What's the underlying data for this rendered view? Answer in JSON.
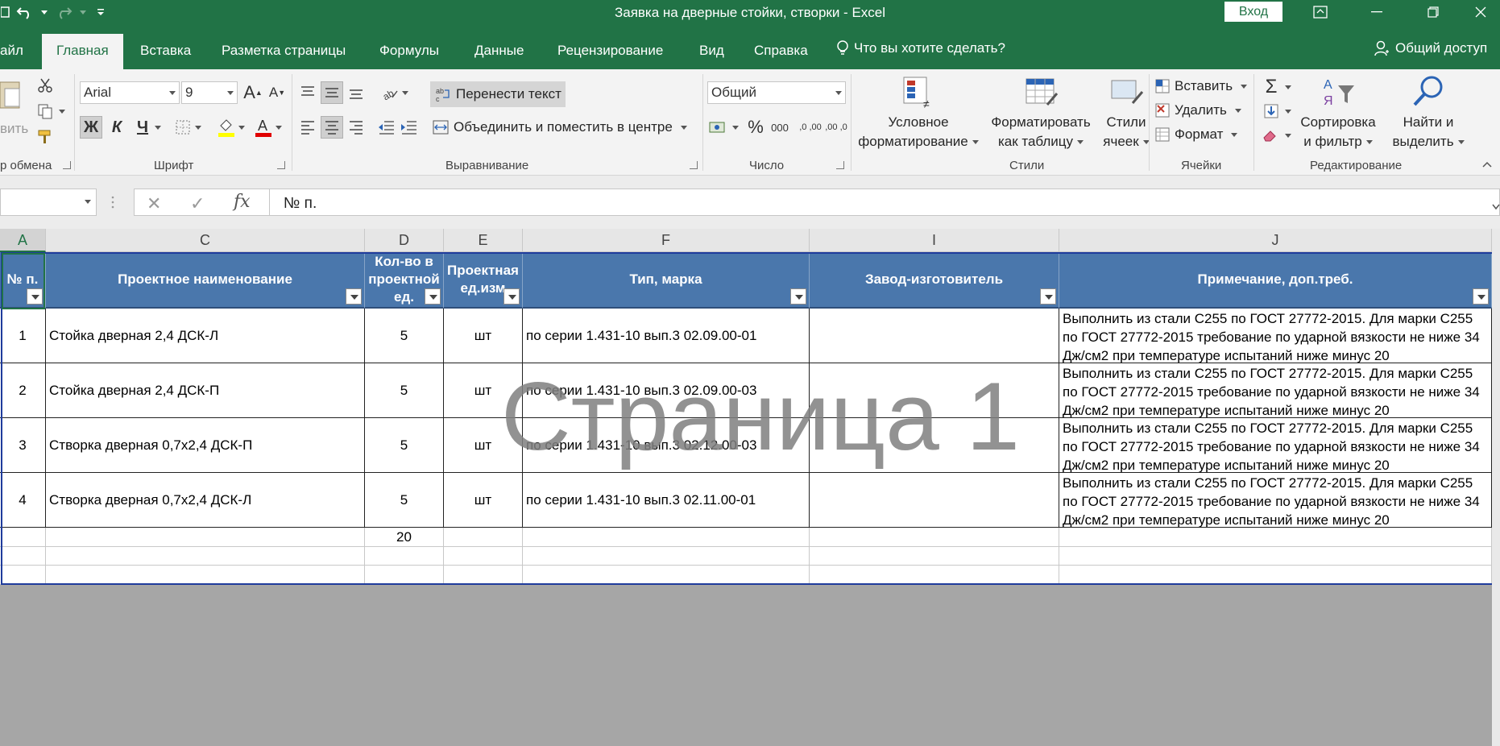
{
  "window": {
    "title": "Заявка на дверные стойки, створки  -  Excel",
    "signin": "Вход"
  },
  "tabs": [
    {
      "label": "айл"
    },
    {
      "label": "Главная"
    },
    {
      "label": "Вставка"
    },
    {
      "label": "Разметка страницы"
    },
    {
      "label": "Формулы"
    },
    {
      "label": "Данные"
    },
    {
      "label": "Рецензирование"
    },
    {
      "label": "Вид"
    },
    {
      "label": "Справка"
    }
  ],
  "tellme": "Что вы хотите сделать?",
  "share": "Общий доступ",
  "ribbon": {
    "clipboard": {
      "paste_fragment": "вить",
      "label": "р обмена"
    },
    "font": {
      "name": "Arial",
      "size": "9",
      "bold": "Ж",
      "italic": "К",
      "underline": "Ч",
      "label": "Шрифт"
    },
    "alignment": {
      "wrap": "Перенести текст",
      "merge": "Объединить и поместить в центре",
      "label": "Выравнивание"
    },
    "number": {
      "format": "Общий",
      "percent": "%",
      "thousands": "000",
      "inc_dec": ",0 ,00",
      "dec_dec": ",00 ,0",
      "label": "Число"
    },
    "styles": {
      "conditional_1": "Условное",
      "conditional_2": "форматирование",
      "as_table_1": "Форматировать",
      "as_table_2": "как таблицу",
      "cell_styles_1": "Стили",
      "cell_styles_2": "ячеек",
      "label": "Стили"
    },
    "cells": {
      "insert": "Вставить",
      "delete": "Удалить",
      "format": "Формат",
      "label": "Ячейки"
    },
    "editing": {
      "sort_1": "Сортировка",
      "sort_2": "и фильтр",
      "find_1": "Найти и",
      "find_2": "выделить",
      "label": "Редактирование"
    }
  },
  "formula_bar": {
    "fx": "fx",
    "content": "№ п."
  },
  "columns": [
    "A",
    "C",
    "D",
    "E",
    "F",
    "I",
    "J"
  ],
  "table": {
    "headers": [
      "№ п.",
      "Проектное наименование",
      "Кол-во в проектной ед.",
      "Проектная ед.изм",
      "Тип, марка",
      "Завод-изготовитель",
      "Примечание, доп.треб."
    ],
    "rows": [
      {
        "n": "1",
        "name": "Стойка дверная 2,4 ДСК-Л",
        "qty": "5",
        "unit": "шт",
        "type": "по серии 1.431-10 вып.3 02.09.00-01",
        "maker": "",
        "note": "Выполнить из стали С255 по ГОСТ 27772-2015. Для марки С255 по ГОСТ 27772-2015 требование по ударной вязкости не ниже 34 Дж/см2 при температуре испытаний ниже минус 20"
      },
      {
        "n": "2",
        "name": "Стойка дверная 2,4 ДСК-П",
        "qty": "5",
        "unit": "шт",
        "type": "по серии 1.431-10 вып.3 02.09.00-03",
        "maker": "",
        "note": "Выполнить из стали С255 по ГОСТ 27772-2015. Для марки С255 по ГОСТ 27772-2015 требование по ударной вязкости не ниже 34 Дж/см2 при температуре испытаний ниже минус 20"
      },
      {
        "n": "3",
        "name": "Створка дверная 0,7х2,4 ДСК-П",
        "qty": "5",
        "unit": "шт",
        "type": "по серии 1.431-10 вып.3 02.12.00-03",
        "maker": "",
        "note": "Выполнить из стали С255 по ГОСТ 27772-2015. Для марки С255 по ГОСТ 27772-2015 требование по ударной вязкости не ниже 34 Дж/см2 при температуре испытаний ниже минус 20"
      },
      {
        "n": "4",
        "name": "Створка дверная 0,7х2,4 ДСК-Л",
        "qty": "5",
        "unit": "шт",
        "type": "по серии 1.431-10 вып.3 02.11.00-01",
        "maker": "",
        "note": "Выполнить из стали С255 по ГОСТ 27772-2015. Для марки С255 по ГОСТ 27772-2015 требование по ударной вязкости не ниже 34 Дж/см2 при температуре испытаний ниже минус 20"
      }
    ],
    "total": "20"
  },
  "watermark": "Страница 1",
  "colors": {
    "accent": "#217346",
    "table_header": "#4a77ac",
    "print_border": "#1f3c9c"
  }
}
